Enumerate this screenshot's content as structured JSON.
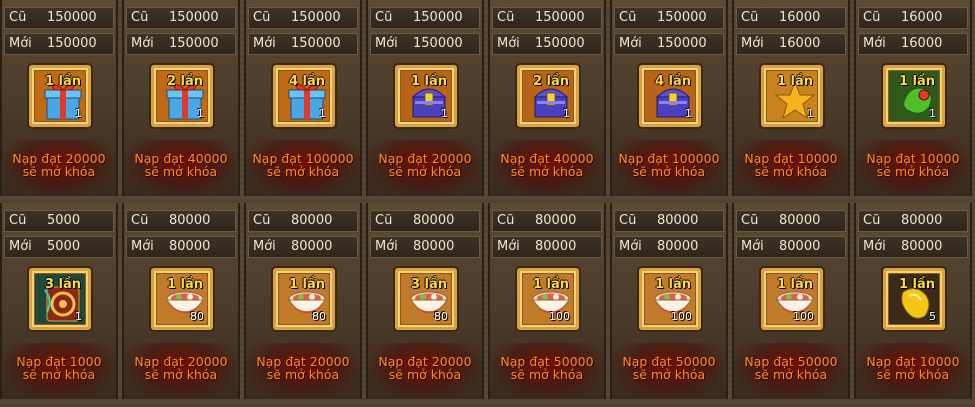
{
  "labels": {
    "old": "Cũ",
    "new": "Mới"
  },
  "cards": [
    {
      "old": "150000",
      "new": "150000",
      "times": "1 lần",
      "qty": "1",
      "req": "Nạp đạt 20000",
      "req2": "sẽ mở khóa",
      "icon": "gift-box-icon",
      "bg": "#c06a16"
    },
    {
      "old": "150000",
      "new": "150000",
      "times": "2 lần",
      "qty": "1",
      "req": "Nạp đạt 40000",
      "req2": "sẽ mở khóa",
      "icon": "gift-box-icon",
      "bg": "#c06a16"
    },
    {
      "old": "150000",
      "new": "150000",
      "times": "4 lần",
      "qty": "1",
      "req": "Nạp đạt 100000",
      "req2": "sẽ mở khóa",
      "icon": "gift-box-icon",
      "bg": "#c06a16"
    },
    {
      "old": "150000",
      "new": "150000",
      "times": "1 lần",
      "qty": "1",
      "req": "Nạp đạt 20000",
      "req2": "sẽ mở khóa",
      "icon": "treasure-chest-icon",
      "bg": "#b76418"
    },
    {
      "old": "150000",
      "new": "150000",
      "times": "2 lần",
      "qty": "1",
      "req": "Nạp đạt 40000",
      "req2": "sẽ mở khóa",
      "icon": "treasure-chest-icon",
      "bg": "#b76418"
    },
    {
      "old": "150000",
      "new": "150000",
      "times": "4 lần",
      "qty": "1",
      "req": "Nạp đạt 100000",
      "req2": "sẽ mở khóa",
      "icon": "treasure-chest-icon",
      "bg": "#b76418"
    },
    {
      "old": "16000",
      "new": "16000",
      "times": "1 lần",
      "qty": "1",
      "req": "Nạp đạt 10000",
      "req2": "sẽ mở khóa",
      "icon": "star-icon",
      "bg": "#c9821e"
    },
    {
      "old": "16000",
      "new": "16000",
      "times": "1 lần",
      "qty": "1",
      "req": "Nạp đạt 10000",
      "req2": "sẽ mở khóa",
      "icon": "green-gem-icon",
      "bg": "#2f5a1c"
    },
    {
      "old": "5000",
      "new": "5000",
      "times": "3 lần",
      "qty": "1",
      "req": "Nạp đạt 1000",
      "req2": "sẽ mở khóa",
      "icon": "rune-scroll-icon",
      "bg": "#1f4a3a"
    },
    {
      "old": "80000",
      "new": "80000",
      "times": "1 lần",
      "qty": "80",
      "req": "Nạp đạt 20000",
      "req2": "sẽ mở khóa",
      "icon": "noodle-bowl-icon",
      "bg": "#c07a2a"
    },
    {
      "old": "80000",
      "new": "80000",
      "times": "1 lần",
      "qty": "80",
      "req": "Nạp đạt 20000",
      "req2": "sẽ mở khóa",
      "icon": "noodle-bowl-icon",
      "bg": "#c07a2a"
    },
    {
      "old": "80000",
      "new": "80000",
      "times": "3 lần",
      "qty": "80",
      "req": "Nạp đạt 20000",
      "req2": "sẽ mở khóa",
      "icon": "noodle-bowl-icon",
      "bg": "#c07a2a"
    },
    {
      "old": "80000",
      "new": "80000",
      "times": "1 lần",
      "qty": "100",
      "req": "Nạp đạt 50000",
      "req2": "sẽ mở khóa",
      "icon": "noodle-bowl-icon",
      "bg": "#c07a2a"
    },
    {
      "old": "80000",
      "new": "80000",
      "times": "1 lần",
      "qty": "100",
      "req": "Nạp đạt 50000",
      "req2": "sẽ mở khóa",
      "icon": "noodle-bowl-icon",
      "bg": "#c07a2a"
    },
    {
      "old": "80000",
      "new": "80000",
      "times": "1 lần",
      "qty": "100",
      "req": "Nạp đạt 50000",
      "req2": "sẽ mở khóa",
      "icon": "noodle-bowl-icon",
      "bg": "#c07a2a"
    },
    {
      "old": "80000",
      "new": "80000",
      "times": "1 lần",
      "qty": "5",
      "req": "Nạp đạt 10000",
      "req2": "sẽ mở khóa",
      "icon": "gold-ingot-icon",
      "bg": "#3a2a18"
    }
  ]
}
